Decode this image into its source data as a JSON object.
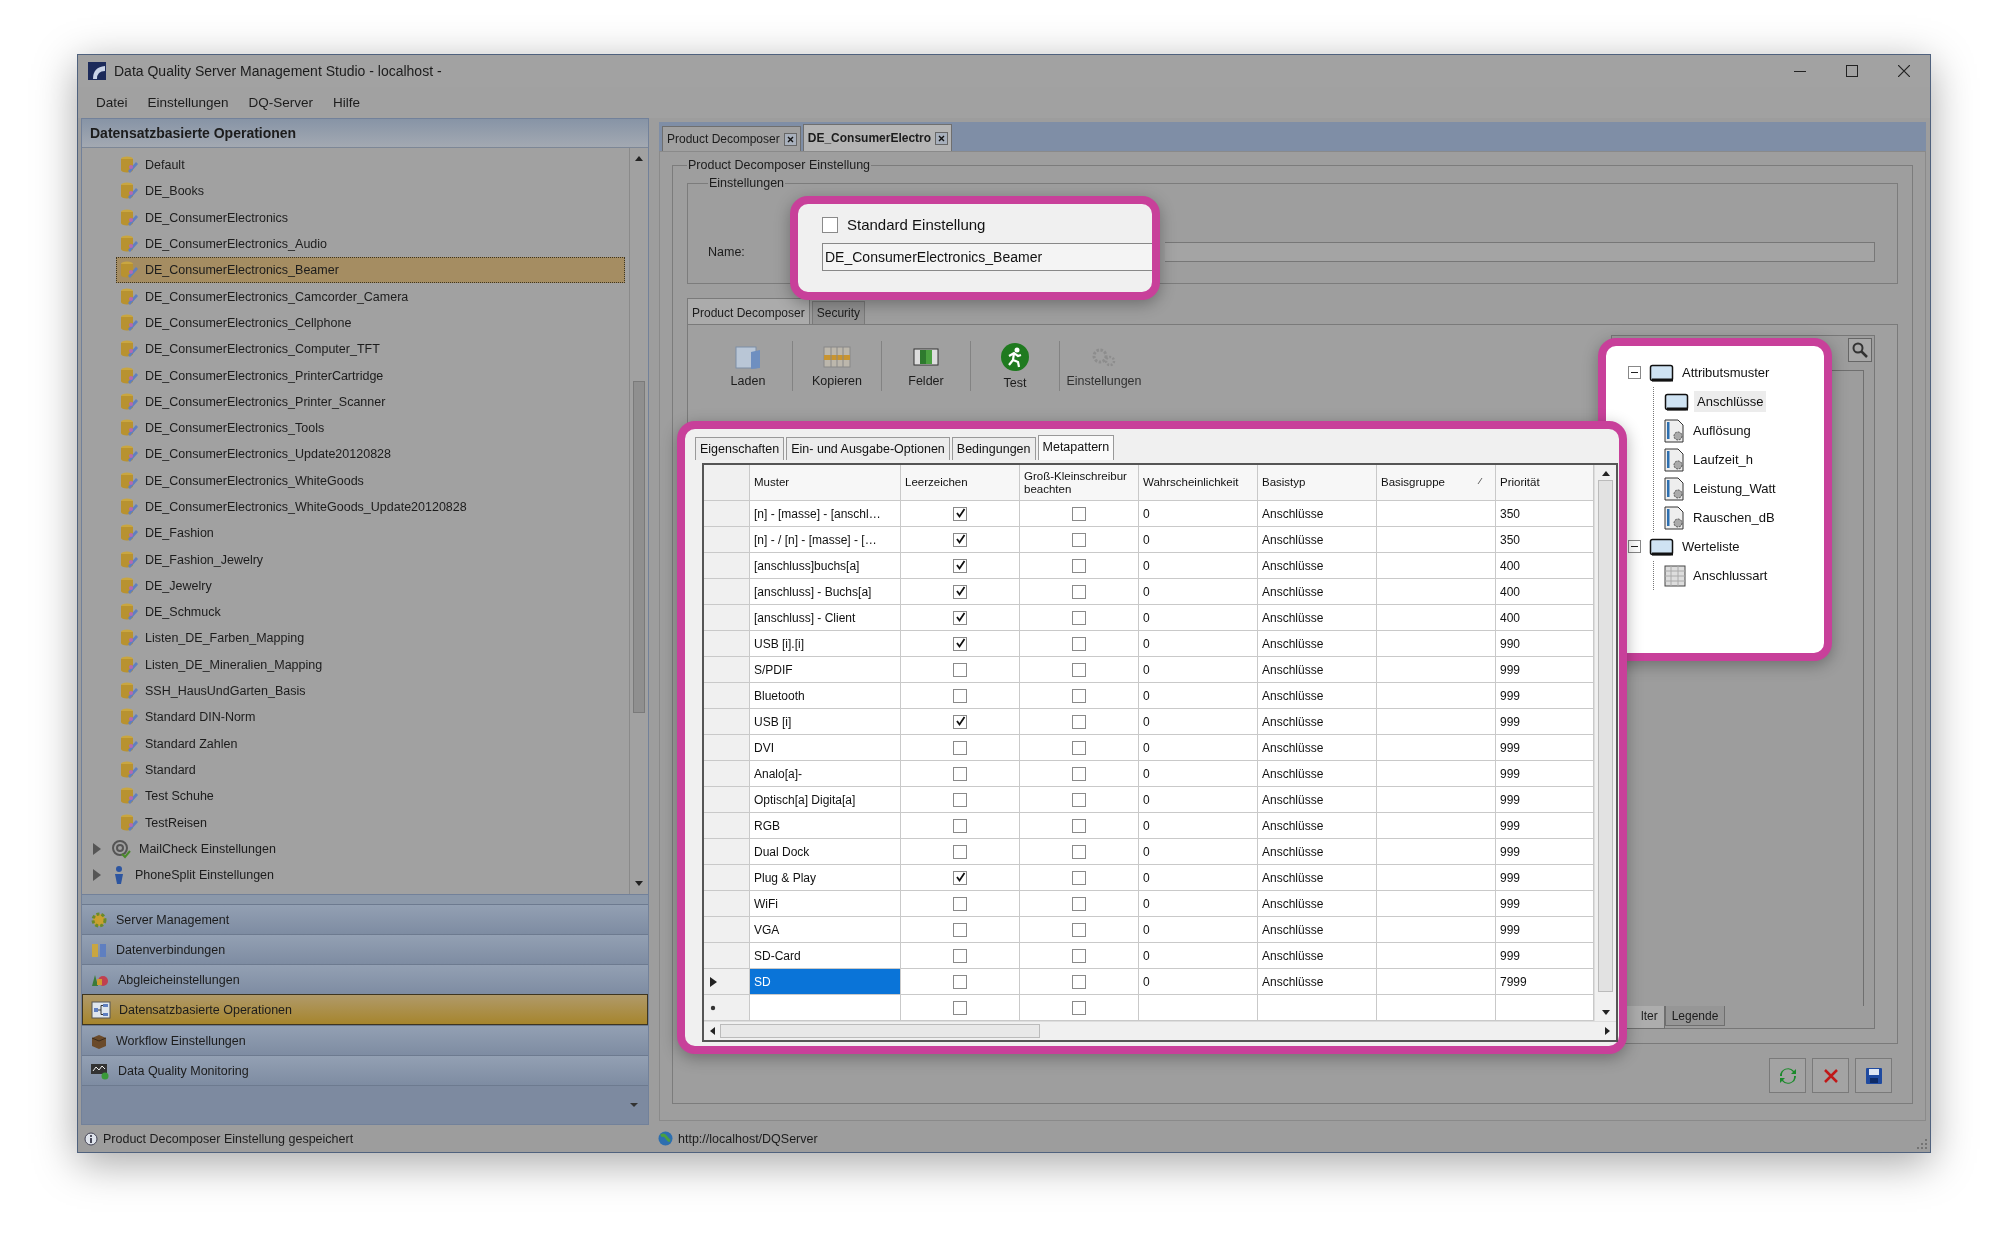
{
  "window": {
    "title": "Data Quality Server Management Studio - localhost -"
  },
  "menu": [
    "Datei",
    "Einstellungen",
    "DQ-Server",
    "Hilfe"
  ],
  "sidebar": {
    "title": "Datensatzbasierte Operationen",
    "items": [
      {
        "label": "Default",
        "kind": "operation",
        "selected": false
      },
      {
        "label": "DE_Books",
        "kind": "operation",
        "selected": false
      },
      {
        "label": "DE_ConsumerElectronics",
        "kind": "operation",
        "selected": false
      },
      {
        "label": "DE_ConsumerElectronics_Audio",
        "kind": "operation",
        "selected": false
      },
      {
        "label": "DE_ConsumerElectronics_Beamer",
        "kind": "operation",
        "selected": true
      },
      {
        "label": "DE_ConsumerElectronics_Camcorder_Camera",
        "kind": "operation",
        "selected": false
      },
      {
        "label": "DE_ConsumerElectronics_Cellphone",
        "kind": "operation",
        "selected": false
      },
      {
        "label": "DE_ConsumerElectronics_Computer_TFT",
        "kind": "operation",
        "selected": false
      },
      {
        "label": "DE_ConsumerElectronics_PrinterCartridge",
        "kind": "operation",
        "selected": false
      },
      {
        "label": "DE_ConsumerElectronics_Printer_Scanner",
        "kind": "operation",
        "selected": false
      },
      {
        "label": "DE_ConsumerElectronics_Tools",
        "kind": "operation",
        "selected": false
      },
      {
        "label": "DE_ConsumerElectronics_Update20120828",
        "kind": "operation",
        "selected": false
      },
      {
        "label": "DE_ConsumerElectronics_WhiteGoods",
        "kind": "operation",
        "selected": false
      },
      {
        "label": "DE_ConsumerElectronics_WhiteGoods_Update20120828",
        "kind": "operation",
        "selected": false
      },
      {
        "label": "DE_Fashion",
        "kind": "operation",
        "selected": false
      },
      {
        "label": "DE_Fashion_Jewelry",
        "kind": "operation",
        "selected": false
      },
      {
        "label": "DE_Jewelry",
        "kind": "operation",
        "selected": false
      },
      {
        "label": "DE_Schmuck",
        "kind": "operation",
        "selected": false
      },
      {
        "label": "Listen_DE_Farben_Mapping",
        "kind": "operation",
        "selected": false
      },
      {
        "label": "Listen_DE_Mineralien_Mapping",
        "kind": "operation",
        "selected": false
      },
      {
        "label": "SSH_HausUndGarten_Basis",
        "kind": "operation",
        "selected": false
      },
      {
        "label": "Standard DIN-Norm",
        "kind": "operation",
        "selected": false
      },
      {
        "label": "Standard Zahlen",
        "kind": "operation",
        "selected": false
      },
      {
        "label": "Standard",
        "kind": "operation",
        "selected": false
      },
      {
        "label": "Test Schuhe",
        "kind": "operation",
        "selected": false
      },
      {
        "label": "TestReisen",
        "kind": "operation",
        "selected": false
      },
      {
        "label": "MailCheck Einstellungen",
        "kind": "mailcheck",
        "selected": false,
        "expanded": false
      },
      {
        "label": "PhoneSplit Einstellungen",
        "kind": "phonesplit",
        "selected": false,
        "expanded": false
      }
    ]
  },
  "nav_buttons": [
    {
      "label": "Server Management",
      "kind": "server",
      "selected": false
    },
    {
      "label": "Datenverbindungen",
      "kind": "connections",
      "selected": false
    },
    {
      "label": "Abgleicheinstellungen",
      "kind": "matching",
      "selected": false
    },
    {
      "label": "Datensatzbasierte Operationen",
      "kind": "records",
      "selected": true
    },
    {
      "label": "Workflow Einstellungen",
      "kind": "workflow",
      "selected": false
    },
    {
      "label": "Data Quality Monitoring",
      "kind": "monitoring",
      "selected": false
    }
  ],
  "doc_tabs": [
    {
      "label": "Product Decomposer",
      "selected": false
    },
    {
      "label": "DE_ConsumerElectro",
      "selected": true
    }
  ],
  "settings": {
    "group_title": "Product Decomposer Einstellung",
    "subgroup_title": "Einstellungen",
    "standard_checkbox": {
      "label": "Standard Einstellung",
      "checked": false
    },
    "name_label": "Name:",
    "name_value": "DE_ConsumerElectronics_Beamer"
  },
  "inner_tabs": [
    {
      "label": "Product Decomposer",
      "selected": true
    },
    {
      "label": "Security",
      "selected": false
    }
  ],
  "toolbar": [
    {
      "label": "Laden",
      "kind": "load",
      "disabled": false
    },
    {
      "label": "Kopieren",
      "kind": "copy",
      "disabled": false
    },
    {
      "label": "Felder",
      "kind": "fields",
      "disabled": false
    },
    {
      "label": "Test",
      "kind": "test",
      "disabled": false
    },
    {
      "label": "Einstellungen",
      "kind": "settings",
      "disabled": true
    }
  ],
  "pattern_tabs": [
    {
      "label": "Eigenschaften",
      "selected": false
    },
    {
      "label": "Ein- und Ausgabe-Optionen",
      "selected": false
    },
    {
      "label": "Bedingungen",
      "selected": false
    },
    {
      "label": "Metapattern",
      "selected": true
    }
  ],
  "table": {
    "columns": [
      {
        "label": "Muster",
        "sorted": false
      },
      {
        "label": "Leerzeichen",
        "sorted": false
      },
      {
        "label": "Groß-Kleinschreibur\nbeachten",
        "sorted": false
      },
      {
        "label": "Wahrscheinlichkeit",
        "sorted": false
      },
      {
        "label": "Basistyp",
        "sorted": false
      },
      {
        "label": "Basisgruppe",
        "sorted": true
      },
      {
        "label": "Priorität",
        "sorted": false
      }
    ],
    "rows": [
      {
        "pattern": "[n] - [masse] - [anschl…",
        "spaces": true,
        "case_sensitive": false,
        "probability": "0",
        "base_type": "Anschlüsse",
        "priority": "350",
        "selected": false
      },
      {
        "pattern": "[n] - / [n] - [masse] - […",
        "spaces": true,
        "case_sensitive": false,
        "probability": "0",
        "base_type": "Anschlüsse",
        "priority": "350",
        "selected": false
      },
      {
        "pattern": "[anschluss]buchs[a]",
        "spaces": true,
        "case_sensitive": false,
        "probability": "0",
        "base_type": "Anschlüsse",
        "priority": "400",
        "selected": false
      },
      {
        "pattern": "[anschluss] - Buchs[a]",
        "spaces": true,
        "case_sensitive": false,
        "probability": "0",
        "base_type": "Anschlüsse",
        "priority": "400",
        "selected": false
      },
      {
        "pattern": "[anschluss] - Client",
        "spaces": true,
        "case_sensitive": false,
        "probability": "0",
        "base_type": "Anschlüsse",
        "priority": "400",
        "selected": false
      },
      {
        "pattern": "USB [i].[i]",
        "spaces": true,
        "case_sensitive": false,
        "probability": "0",
        "base_type": "Anschlüsse",
        "priority": "990",
        "selected": false
      },
      {
        "pattern": "S/PDIF",
        "spaces": false,
        "case_sensitive": false,
        "probability": "0",
        "base_type": "Anschlüsse",
        "priority": "999",
        "selected": false
      },
      {
        "pattern": "Bluetooth",
        "spaces": false,
        "case_sensitive": false,
        "probability": "0",
        "base_type": "Anschlüsse",
        "priority": "999",
        "selected": false
      },
      {
        "pattern": "USB [i]",
        "spaces": true,
        "case_sensitive": false,
        "probability": "0",
        "base_type": "Anschlüsse",
        "priority": "999",
        "selected": false
      },
      {
        "pattern": "DVI",
        "spaces": false,
        "case_sensitive": false,
        "probability": "0",
        "base_type": "Anschlüsse",
        "priority": "999",
        "selected": false
      },
      {
        "pattern": "Analo[a]-",
        "spaces": false,
        "case_sensitive": false,
        "probability": "0",
        "base_type": "Anschlüsse",
        "priority": "999",
        "selected": false
      },
      {
        "pattern": "Optisch[a] Digita[a]",
        "spaces": false,
        "case_sensitive": false,
        "probability": "0",
        "base_type": "Anschlüsse",
        "priority": "999",
        "selected": false
      },
      {
        "pattern": "RGB",
        "spaces": false,
        "case_sensitive": false,
        "probability": "0",
        "base_type": "Anschlüsse",
        "priority": "999",
        "selected": false
      },
      {
        "pattern": "Dual Dock",
        "spaces": false,
        "case_sensitive": false,
        "probability": "0",
        "base_type": "Anschlüsse",
        "priority": "999",
        "selected": false
      },
      {
        "pattern": "Plug & Play",
        "spaces": true,
        "case_sensitive": false,
        "probability": "0",
        "base_type": "Anschlüsse",
        "priority": "999",
        "selected": false
      },
      {
        "pattern": "WiFi",
        "spaces": false,
        "case_sensitive": false,
        "probability": "0",
        "base_type": "Anschlüsse",
        "priority": "999",
        "selected": false
      },
      {
        "pattern": "VGA",
        "spaces": false,
        "case_sensitive": false,
        "probability": "0",
        "base_type": "Anschlüsse",
        "priority": "999",
        "selected": false
      },
      {
        "pattern": "SD-Card",
        "spaces": false,
        "case_sensitive": false,
        "probability": "0",
        "base_type": "Anschlüsse",
        "priority": "999",
        "selected": false
      },
      {
        "pattern": "SD",
        "spaces": false,
        "case_sensitive": false,
        "probability": "0",
        "base_type": "Anschlüsse",
        "priority": "7999",
        "selected": true
      }
    ],
    "new_row": {
      "spaces": false,
      "case_sensitive": false
    }
  },
  "attribute_tree": [
    {
      "label": "Attributsmuster",
      "kind": "folder",
      "expanded": true,
      "selected": false,
      "children": [
        {
          "label": "Anschlüsse",
          "kind": "folder",
          "selected": true
        },
        {
          "label": "Auflösung",
          "kind": "document",
          "selected": false
        },
        {
          "label": "Laufzeit_h",
          "kind": "document",
          "selected": false
        },
        {
          "label": "Leistung_Watt",
          "kind": "document",
          "selected": false
        },
        {
          "label": "Rauschen_dB",
          "kind": "document",
          "selected": false
        }
      ]
    },
    {
      "label": "Werteliste",
      "kind": "folder",
      "expanded": true,
      "selected": false,
      "children": [
        {
          "label": "Anschlussart",
          "kind": "grid",
          "selected": false
        }
      ]
    }
  ],
  "panel_tabs": [
    {
      "label": "lter",
      "selected": true
    },
    {
      "label": "Legende",
      "selected": false
    }
  ],
  "action_buttons": [
    {
      "kind": "refresh"
    },
    {
      "kind": "cancel"
    },
    {
      "kind": "save"
    }
  ],
  "status_bar": {
    "message": "Product Decomposer Einstellung gespeichert",
    "url": "http://localhost/DQServer"
  }
}
